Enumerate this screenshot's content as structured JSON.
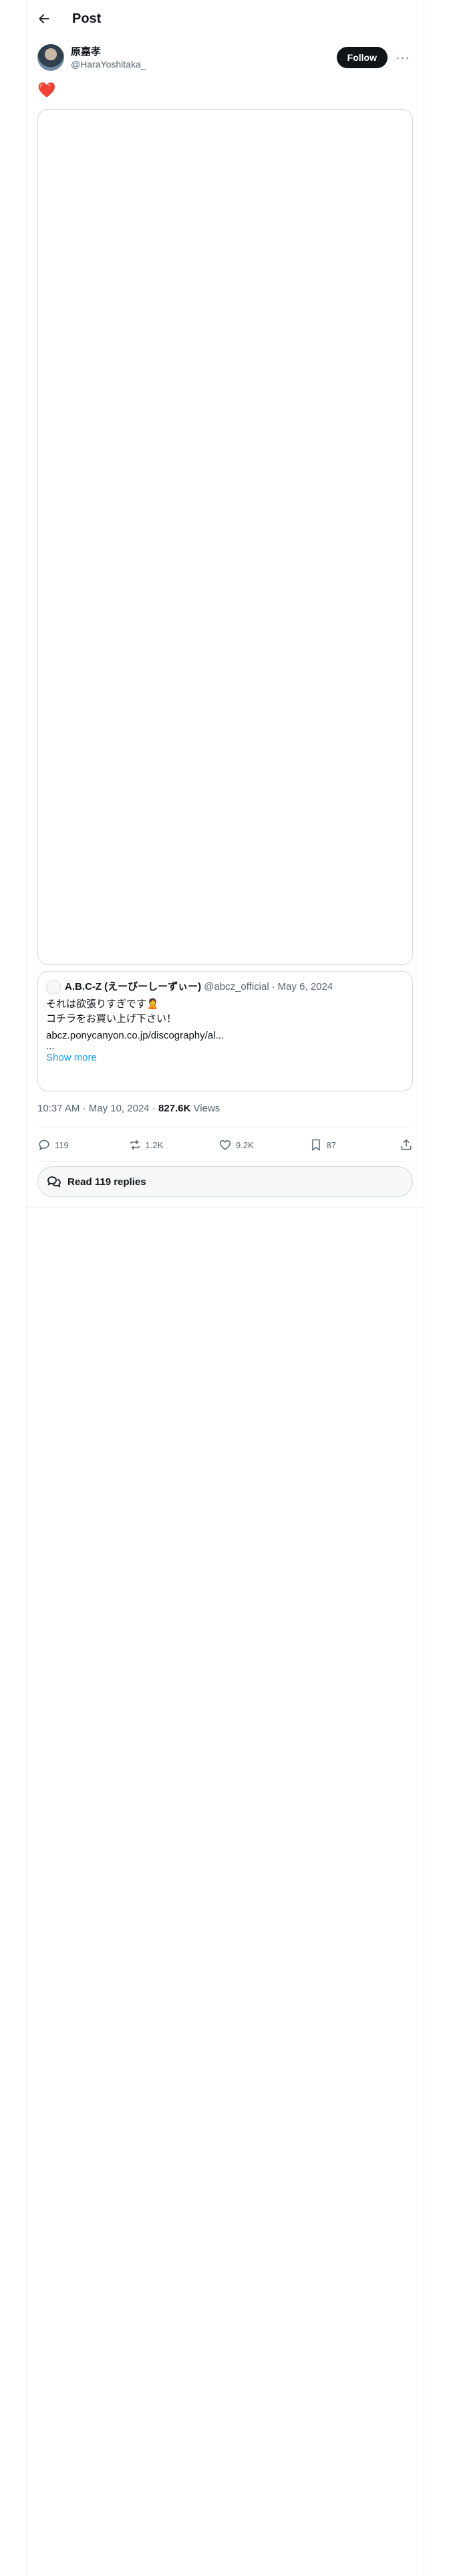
{
  "header": {
    "title": "Post",
    "back_icon": "arrow-left-icon"
  },
  "author": {
    "display_name": "原嘉孝",
    "handle": "@HaraYoshitaka_",
    "follow_label": "Follow",
    "more_label": "···"
  },
  "post": {
    "text": "❤️"
  },
  "quote": {
    "name": "A.B.C-Z (えーびーしーずぃー)",
    "handle": "@abcz_official",
    "date": "May 6, 2024",
    "sep": "·",
    "text": "それは欲張りすぎです🙎\nコチラをお買い上げ下さい！",
    "link": "abcz.ponycanyon.co.jp/discography/al...",
    "ellipsis": "...",
    "show_more": "Show more"
  },
  "meta": {
    "time": "10:37 AM",
    "date": "May 10, 2024",
    "views": "827.6K",
    "views_label": "Views",
    "sep": "·"
  },
  "actions": {
    "replies": "119",
    "reposts": "1.2K",
    "likes": "9.2K",
    "bookmarks": "87"
  },
  "read_replies_label": "Read 119 replies",
  "colors": {
    "follow_bg": "#0f1419",
    "link": "#1d9bf0",
    "heart": "#e0245e"
  }
}
